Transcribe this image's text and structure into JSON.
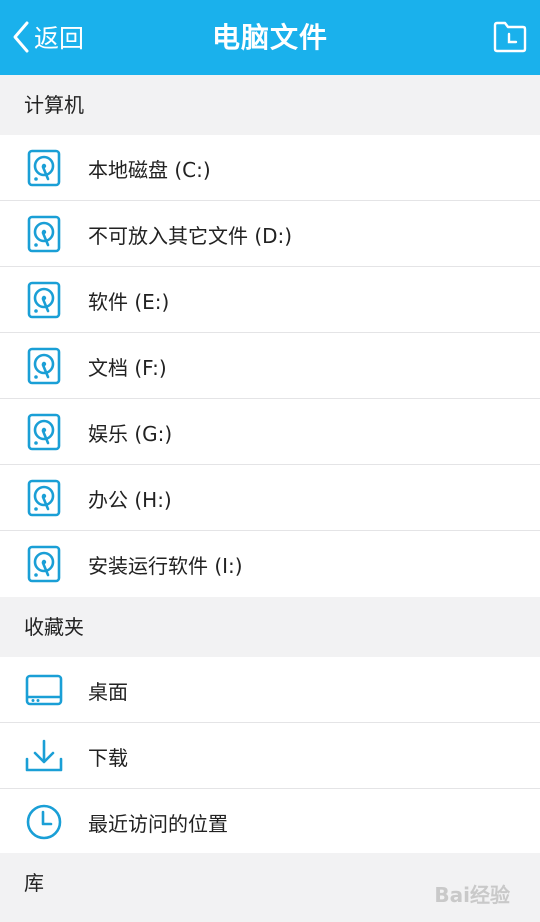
{
  "header": {
    "back_label": "返回",
    "title": "电脑文件"
  },
  "colors": {
    "accent": "#1ab1ec",
    "icon": "#1a9fd6"
  },
  "sections": [
    {
      "label": "计算机",
      "items": [
        {
          "label": "本地磁盘 (C:)",
          "icon": "hard-disk-icon"
        },
        {
          "label": "不可放入其它文件 (D:)",
          "icon": "hard-disk-icon"
        },
        {
          "label": "软件 (E:)",
          "icon": "hard-disk-icon"
        },
        {
          "label": "文档 (F:)",
          "icon": "hard-disk-icon"
        },
        {
          "label": "娱乐 (G:)",
          "icon": "hard-disk-icon"
        },
        {
          "label": "办公 (H:)",
          "icon": "hard-disk-icon"
        },
        {
          "label": "安装运行软件 (I:)",
          "icon": "hard-disk-icon"
        }
      ]
    },
    {
      "label": "收藏夹",
      "items": [
        {
          "label": "桌面",
          "icon": "desktop-icon"
        },
        {
          "label": "下载",
          "icon": "download-icon"
        },
        {
          "label": "最近访问的位置",
          "icon": "clock-icon"
        }
      ]
    },
    {
      "label": "库",
      "items": []
    }
  ],
  "watermark": "Bai经验"
}
